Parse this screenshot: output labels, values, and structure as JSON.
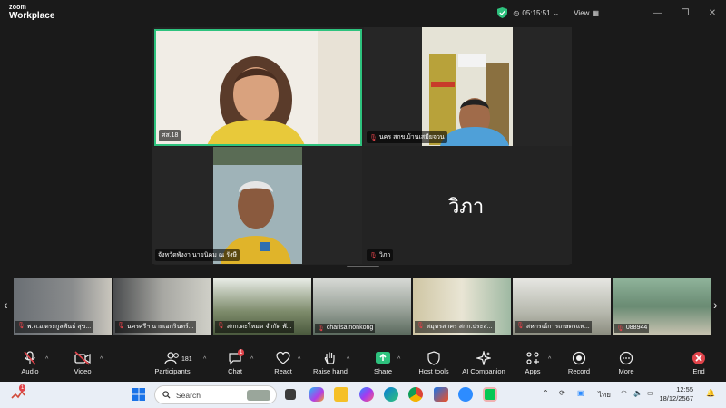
{
  "app": {
    "brand_top": "zoom",
    "brand_bottom": "Workplace"
  },
  "titlebar": {
    "timer": "05:15:51",
    "view_label": "View"
  },
  "gallery": {
    "tiles": [
      {
        "name": "ศส.18"
      },
      {
        "name": "นคร สกข.บ้านเสมียจวน"
      },
      {
        "name": "จังหวัดพังงา นายนิคม ณ รังษี"
      },
      {
        "name": "วิภา",
        "display_name": "วิภา"
      }
    ]
  },
  "strip": {
    "thumbs": [
      {
        "name": "พ.ต.อ.ตระกูลพันธ์ สุข..."
      },
      {
        "name": "นครศรีฯ นายเอกรินทร์..."
      },
      {
        "name": "สกก.ตะโหมด จำกัด พั..."
      },
      {
        "name": "charisa nonkong"
      },
      {
        "name": "สมุทรสาคร สกก.ประส..."
      },
      {
        "name": "สหกรณ์การเกษตรแพ..."
      },
      {
        "name": "088944"
      }
    ]
  },
  "toolbar": {
    "audio": "Audio",
    "video": "Video",
    "participants": "Participants",
    "participants_count": "181",
    "chat": "Chat",
    "chat_badge": "1",
    "react": "React",
    "raise_hand": "Raise hand",
    "share": "Share",
    "host_tools": "Host tools",
    "ai_companion": "AI Companion",
    "apps": "Apps",
    "record": "Record",
    "more": "More",
    "end": "End"
  },
  "taskbar": {
    "search_placeholder": "Search",
    "notif_badge": "1",
    "lang": "ไทย",
    "time": "12:55",
    "date": "18/12/2567"
  },
  "colors": {
    "active_speaker": "#2ec27e",
    "end_red": "#e0434a",
    "share_green": "#2ec27e"
  }
}
